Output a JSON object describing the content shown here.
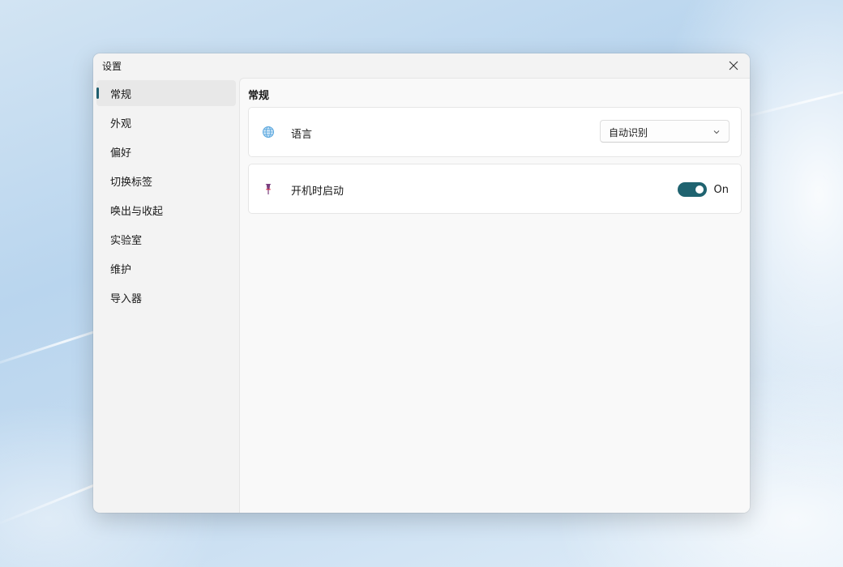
{
  "window": {
    "title": "设置",
    "close_icon": "close-icon"
  },
  "sidebar": {
    "active_index": 0,
    "accent_color": "#1f5e6e",
    "items": [
      {
        "label": "常规"
      },
      {
        "label": "外观"
      },
      {
        "label": "偏好"
      },
      {
        "label": "切换标签"
      },
      {
        "label": "唤出与收起"
      },
      {
        "label": "实验室"
      },
      {
        "label": "维护"
      },
      {
        "label": "导入器"
      }
    ]
  },
  "main": {
    "section_title": "常规",
    "language": {
      "icon": "globe-icon",
      "label": "语言",
      "selected": "自动识别"
    },
    "startup": {
      "icon": "pin-icon",
      "label": "开机时启动",
      "toggle_state": "On",
      "toggle_color": "#1f6370"
    }
  }
}
